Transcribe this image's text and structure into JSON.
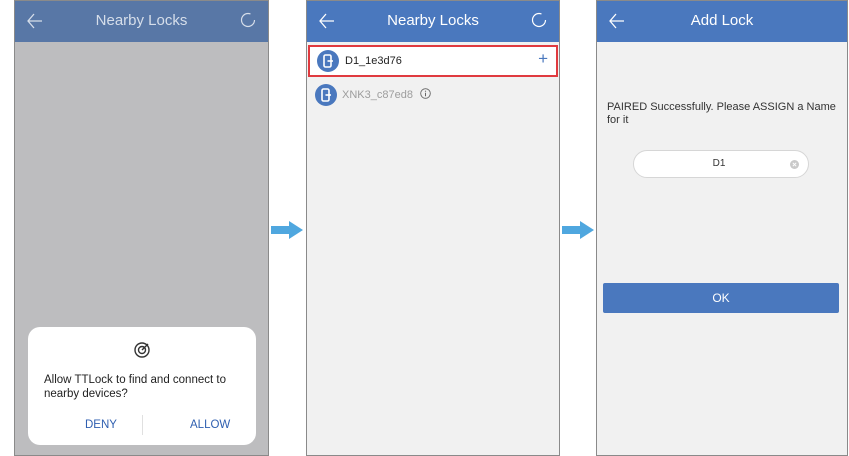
{
  "screen1": {
    "header": {
      "title": "Nearby Locks",
      "back_icon": "back-arrow-icon",
      "refresh_icon": "loading-spinner-icon"
    },
    "permission_dialog": {
      "icon": "nearby-devices-icon",
      "message": "Allow TTLock to find and connect to nearby devices?",
      "deny_label": "DENY",
      "allow_label": "ALLOW"
    }
  },
  "screen2": {
    "header": {
      "title": "Nearby Locks",
      "back_icon": "back-arrow-icon",
      "refresh_icon": "loading-spinner-icon"
    },
    "locks": [
      {
        "name": "D1_1e3d76",
        "action": "+",
        "icon": "lock-icon",
        "highlighted": true
      },
      {
        "name": "XNK3_c87ed8",
        "icon": "lock-icon",
        "info_icon": "info-icon",
        "highlighted": false
      }
    ]
  },
  "screen3": {
    "header": {
      "title": "Add Lock",
      "back_icon": "back-arrow-icon"
    },
    "message": "PAIRED Successfully. Please ASSIGN a Name for it",
    "name_field": {
      "value": "D1",
      "clear_icon": "clear-icon"
    },
    "ok_label": "OK"
  },
  "colors": {
    "header_blue": "#4a78be",
    "highlight_red": "#e03a3f",
    "arrow_blue": "#4fa7df"
  }
}
